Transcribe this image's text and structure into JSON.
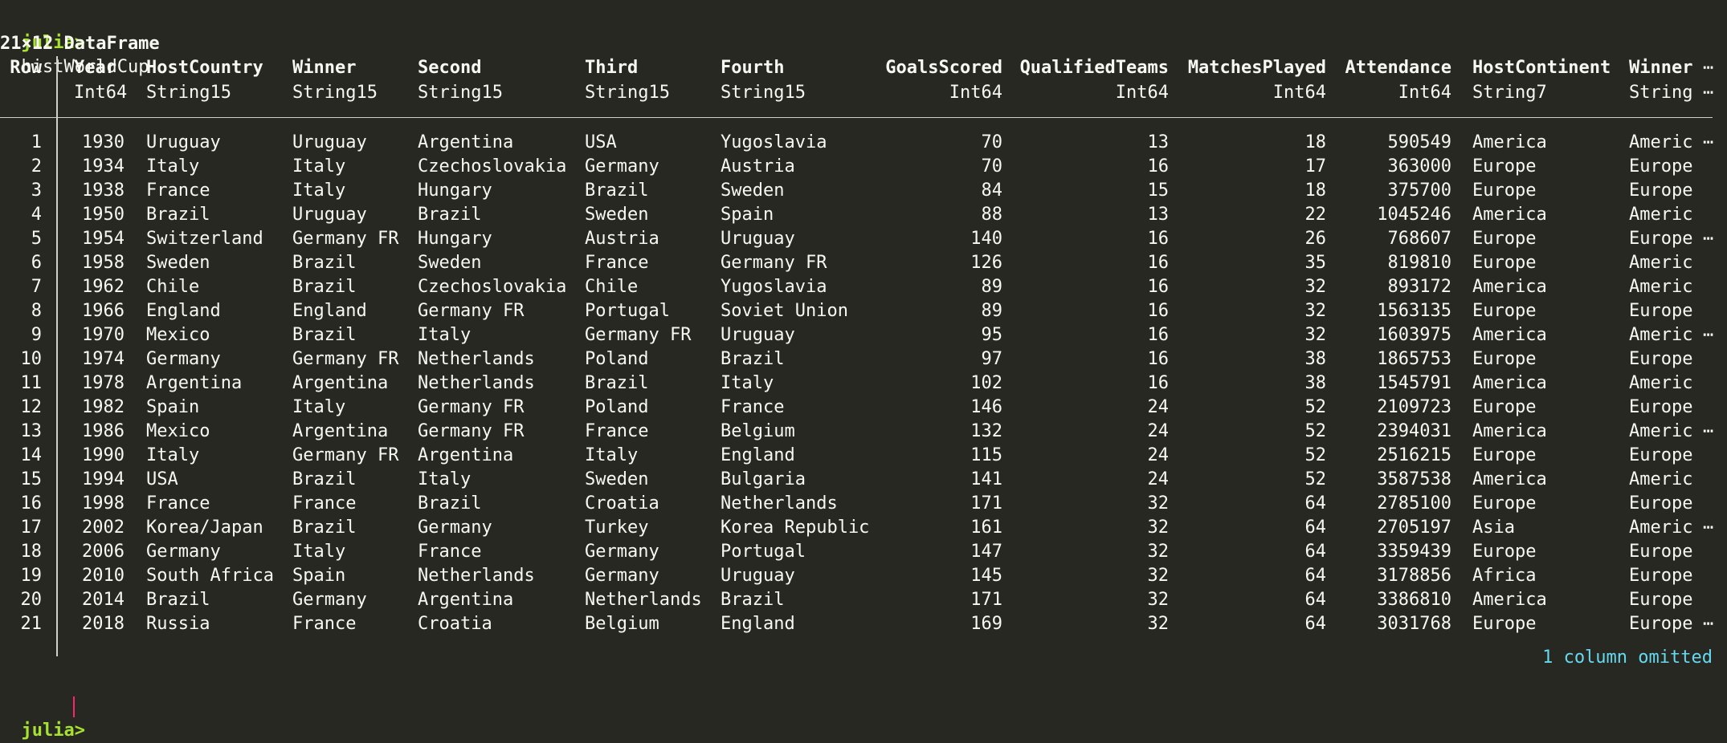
{
  "terminal": {
    "prompt": "julia>",
    "command": "histWorldCup",
    "summary": "21×12 DataFrame",
    "omitted_note": "1 column omitted",
    "ellipsis": "⋯"
  },
  "table": {
    "columns": [
      {
        "name": "Row",
        "type": ""
      },
      {
        "name": "Year",
        "type": "Int64"
      },
      {
        "name": "HostCountry",
        "type": "String15"
      },
      {
        "name": "Winner",
        "type": "String15"
      },
      {
        "name": "Second",
        "type": "String15"
      },
      {
        "name": "Third",
        "type": "String15"
      },
      {
        "name": "Fourth",
        "type": "String15"
      },
      {
        "name": "GoalsScored",
        "type": "Int64"
      },
      {
        "name": "QualifiedTeams",
        "type": "Int64"
      },
      {
        "name": "MatchesPlayed",
        "type": "Int64"
      },
      {
        "name": "Attendance",
        "type": "Int64"
      },
      {
        "name": "HostContinent",
        "type": "String7"
      },
      {
        "name": "Winner",
        "type": "String"
      }
    ],
    "header_ellipsis": [
      "⋯",
      "⋯"
    ],
    "rows": [
      [
        "1",
        "1930",
        "Uruguay",
        "Uruguay",
        "Argentina",
        "USA",
        "Yugoslavia",
        "70",
        "13",
        "18",
        "590549",
        "America",
        "Americ",
        "⋯"
      ],
      [
        "2",
        "1934",
        "Italy",
        "Italy",
        "Czechoslovakia",
        "Germany",
        "Austria",
        "70",
        "16",
        "17",
        "363000",
        "Europe",
        "Europe",
        ""
      ],
      [
        "3",
        "1938",
        "France",
        "Italy",
        "Hungary",
        "Brazil",
        "Sweden",
        "84",
        "15",
        "18",
        "375700",
        "Europe",
        "Europe",
        ""
      ],
      [
        "4",
        "1950",
        "Brazil",
        "Uruguay",
        "Brazil",
        "Sweden",
        "Spain",
        "88",
        "13",
        "22",
        "1045246",
        "America",
        "Americ",
        ""
      ],
      [
        "5",
        "1954",
        "Switzerland",
        "Germany FR",
        "Hungary",
        "Austria",
        "Uruguay",
        "140",
        "16",
        "26",
        "768607",
        "Europe",
        "Europe",
        "⋯"
      ],
      [
        "6",
        "1958",
        "Sweden",
        "Brazil",
        "Sweden",
        "France",
        "Germany FR",
        "126",
        "16",
        "35",
        "819810",
        "Europe",
        "Americ",
        ""
      ],
      [
        "7",
        "1962",
        "Chile",
        "Brazil",
        "Czechoslovakia",
        "Chile",
        "Yugoslavia",
        "89",
        "16",
        "32",
        "893172",
        "America",
        "Americ",
        ""
      ],
      [
        "8",
        "1966",
        "England",
        "England",
        "Germany FR",
        "Portugal",
        "Soviet Union",
        "89",
        "16",
        "32",
        "1563135",
        "Europe",
        "Europe",
        ""
      ],
      [
        "9",
        "1970",
        "Mexico",
        "Brazil",
        "Italy",
        "Germany FR",
        "Uruguay",
        "95",
        "16",
        "32",
        "1603975",
        "America",
        "Americ",
        "⋯"
      ],
      [
        "10",
        "1974",
        "Germany",
        "Germany FR",
        "Netherlands",
        "Poland",
        "Brazil",
        "97",
        "16",
        "38",
        "1865753",
        "Europe",
        "Europe",
        ""
      ],
      [
        "11",
        "1978",
        "Argentina",
        "Argentina",
        "Netherlands",
        "Brazil",
        "Italy",
        "102",
        "16",
        "38",
        "1545791",
        "America",
        "Americ",
        ""
      ],
      [
        "12",
        "1982",
        "Spain",
        "Italy",
        "Germany FR",
        "Poland",
        "France",
        "146",
        "24",
        "52",
        "2109723",
        "Europe",
        "Europe",
        ""
      ],
      [
        "13",
        "1986",
        "Mexico",
        "Argentina",
        "Germany FR",
        "France",
        "Belgium",
        "132",
        "24",
        "52",
        "2394031",
        "America",
        "Americ",
        "⋯"
      ],
      [
        "14",
        "1990",
        "Italy",
        "Germany FR",
        "Argentina",
        "Italy",
        "England",
        "115",
        "24",
        "52",
        "2516215",
        "Europe",
        "Europe",
        ""
      ],
      [
        "15",
        "1994",
        "USA",
        "Brazil",
        "Italy",
        "Sweden",
        "Bulgaria",
        "141",
        "24",
        "52",
        "3587538",
        "America",
        "Americ",
        ""
      ],
      [
        "16",
        "1998",
        "France",
        "France",
        "Brazil",
        "Croatia",
        "Netherlands",
        "171",
        "32",
        "64",
        "2785100",
        "Europe",
        "Europe",
        ""
      ],
      [
        "17",
        "2002",
        "Korea/Japan",
        "Brazil",
        "Germany",
        "Turkey",
        "Korea Republic",
        "161",
        "32",
        "64",
        "2705197",
        "Asia",
        "Americ",
        "⋯"
      ],
      [
        "18",
        "2006",
        "Germany",
        "Italy",
        "France",
        "Germany",
        "Portugal",
        "147",
        "32",
        "64",
        "3359439",
        "Europe",
        "Europe",
        ""
      ],
      [
        "19",
        "2010",
        "South Africa",
        "Spain",
        "Netherlands",
        "Germany",
        "Uruguay",
        "145",
        "32",
        "64",
        "3178856",
        "Africa",
        "Europe",
        ""
      ],
      [
        "20",
        "2014",
        "Brazil",
        "Germany",
        "Argentina",
        "Netherlands",
        "Brazil",
        "171",
        "32",
        "64",
        "3386810",
        "America",
        "Europe",
        ""
      ],
      [
        "21",
        "2018",
        "Russia",
        "France",
        "Croatia",
        "Belgium",
        "England",
        "169",
        "32",
        "64",
        "3031768",
        "Europe",
        "Europe",
        "⋯"
      ]
    ]
  }
}
